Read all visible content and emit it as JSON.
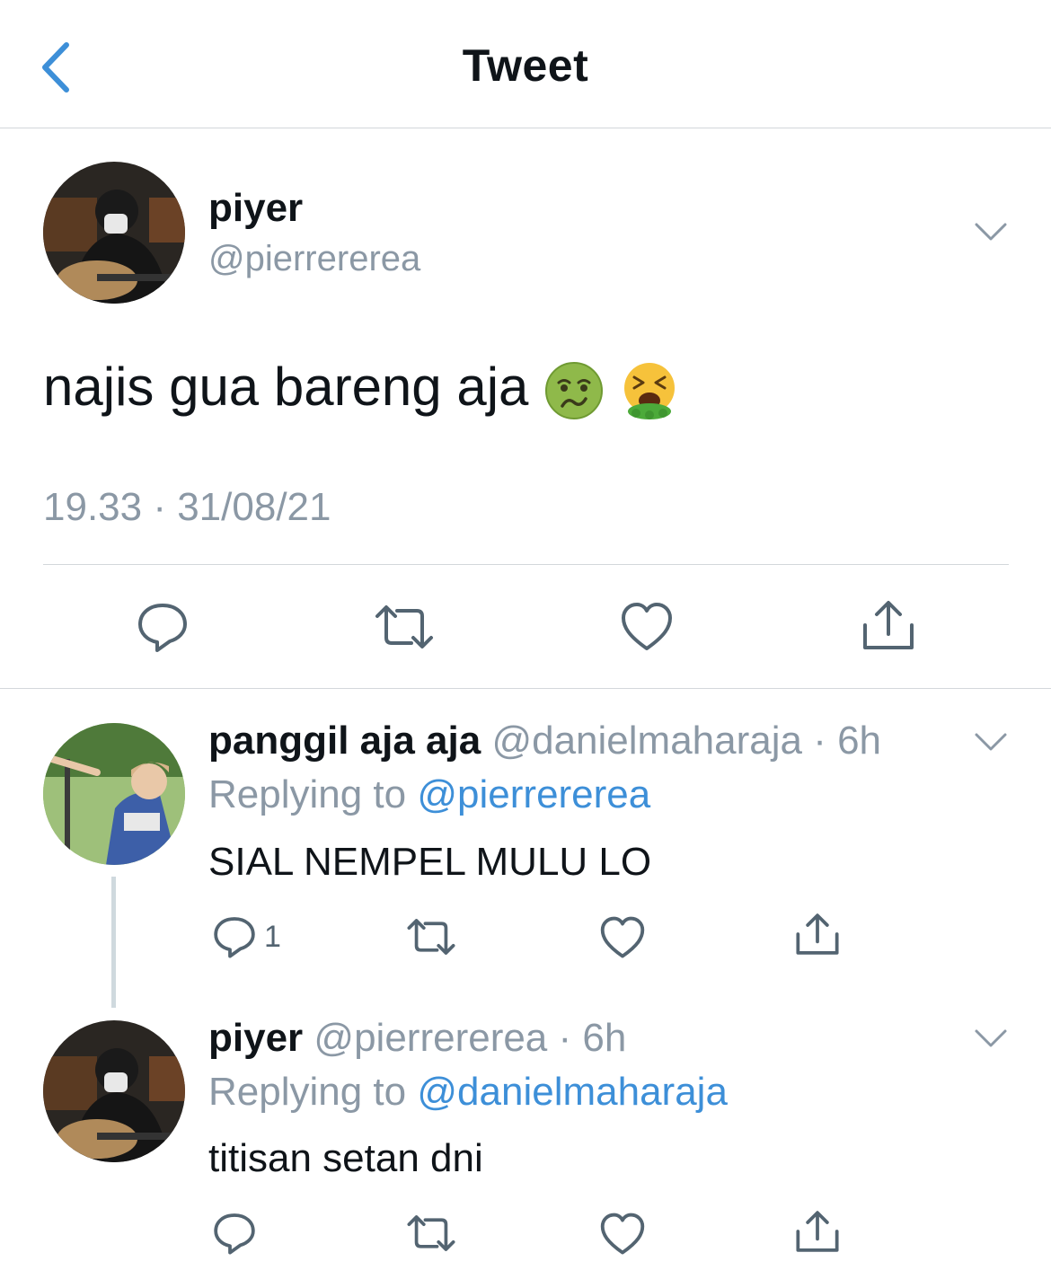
{
  "header": {
    "title": "Tweet",
    "back_icon": "chevron-left-icon",
    "accent": "#3d8fd8"
  },
  "main_tweet": {
    "name": "piyer",
    "handle": "@pierrererea",
    "text": "najis gua bareng aja",
    "emojis": [
      "nauseated-face-emoji",
      "vomiting-face-emoji"
    ],
    "timestamp": "19.33 · 31/08/21",
    "actions": [
      "reply-icon",
      "retweet-icon",
      "like-icon",
      "share-icon"
    ]
  },
  "replies": [
    {
      "name": "panggil aja aja",
      "handle_time": "@danielmaharaja · 6h",
      "replying_label": "Replying to",
      "replying_to": "@pierrererea",
      "text": "SIAL NEMPEL MULU LO",
      "reply_count": "1"
    },
    {
      "name": "piyer",
      "handle_time": "@pierrererea · 6h",
      "replying_label": "Replying to",
      "replying_to": "@danielmaharaja",
      "text": "titisan setan dni",
      "reply_count": ""
    }
  ]
}
